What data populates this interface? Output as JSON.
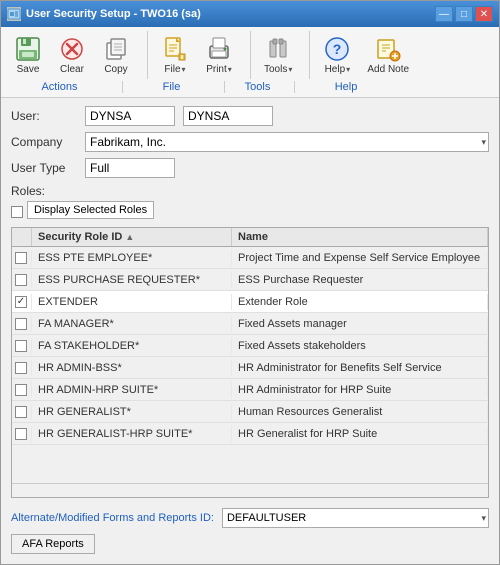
{
  "window": {
    "title": "User Security Setup - TWO16 (sa)",
    "icon": "🔒"
  },
  "titlebar": {
    "minimize_label": "—",
    "maximize_label": "□",
    "close_label": "✕"
  },
  "ribbon": {
    "groups": [
      {
        "name": "Actions",
        "label": "Actions",
        "buttons": [
          {
            "id": "save",
            "label": "Save",
            "icon": "💾"
          },
          {
            "id": "clear",
            "label": "Clear",
            "icon": "🔄"
          },
          {
            "id": "copy",
            "label": "Copy",
            "icon": "📋"
          }
        ]
      },
      {
        "name": "File",
        "label": "File",
        "buttons": [
          {
            "id": "file",
            "label": "File",
            "icon": "📄",
            "split": true
          },
          {
            "id": "print",
            "label": "Print",
            "icon": "🖨",
            "split": true
          }
        ]
      },
      {
        "name": "Tools",
        "label": "Tools",
        "buttons": [
          {
            "id": "tools",
            "label": "Tools",
            "icon": "🔧",
            "split": true
          }
        ]
      },
      {
        "name": "Help",
        "label": "Help",
        "buttons": [
          {
            "id": "help",
            "label": "Help",
            "icon": "❓",
            "split": true
          },
          {
            "id": "addnote",
            "label": "Add Note",
            "icon": "📝"
          }
        ]
      }
    ]
  },
  "form": {
    "user_label": "User:",
    "user_value": "DYNSA",
    "user_value2": "DYNSA",
    "company_label": "Company",
    "company_value": "Fabrikam, Inc.",
    "usertype_label": "User Type",
    "usertype_value": "Full",
    "roles_label": "Roles:",
    "display_selected_label": "Display Selected Roles"
  },
  "table": {
    "col_id": "Security Role ID",
    "col_name": "Name",
    "rows": [
      {
        "id": "ESS PTE EMPLOYEE*",
        "name": "Project Time and Expense Self Service Employee",
        "checked": false
      },
      {
        "id": "ESS PURCHASE REQUESTER*",
        "name": "ESS Purchase Requester",
        "checked": false
      },
      {
        "id": "EXTENDER",
        "name": "Extender Role",
        "checked": true
      },
      {
        "id": "FA MANAGER*",
        "name": "Fixed Assets manager",
        "checked": false
      },
      {
        "id": "FA STAKEHOLDER*",
        "name": "Fixed Assets stakeholders",
        "checked": false
      },
      {
        "id": "HR ADMIN-BSS*",
        "name": "HR Administrator for Benefits Self Service",
        "checked": false
      },
      {
        "id": "HR ADMIN-HRP SUITE*",
        "name": "HR Administrator for HRP Suite",
        "checked": false
      },
      {
        "id": "HR GENERALIST*",
        "name": "Human Resources Generalist",
        "checked": false
      },
      {
        "id": "HR GENERALIST-HRP SUITE*",
        "name": "HR Generalist for HRP Suite",
        "checked": false
      }
    ]
  },
  "bottom": {
    "alt_forms_label": "Alternate/Modified Forms and Reports ID:",
    "alt_forms_value": "DEFAULTUSER",
    "afa_reports_label": "AFA Reports"
  }
}
